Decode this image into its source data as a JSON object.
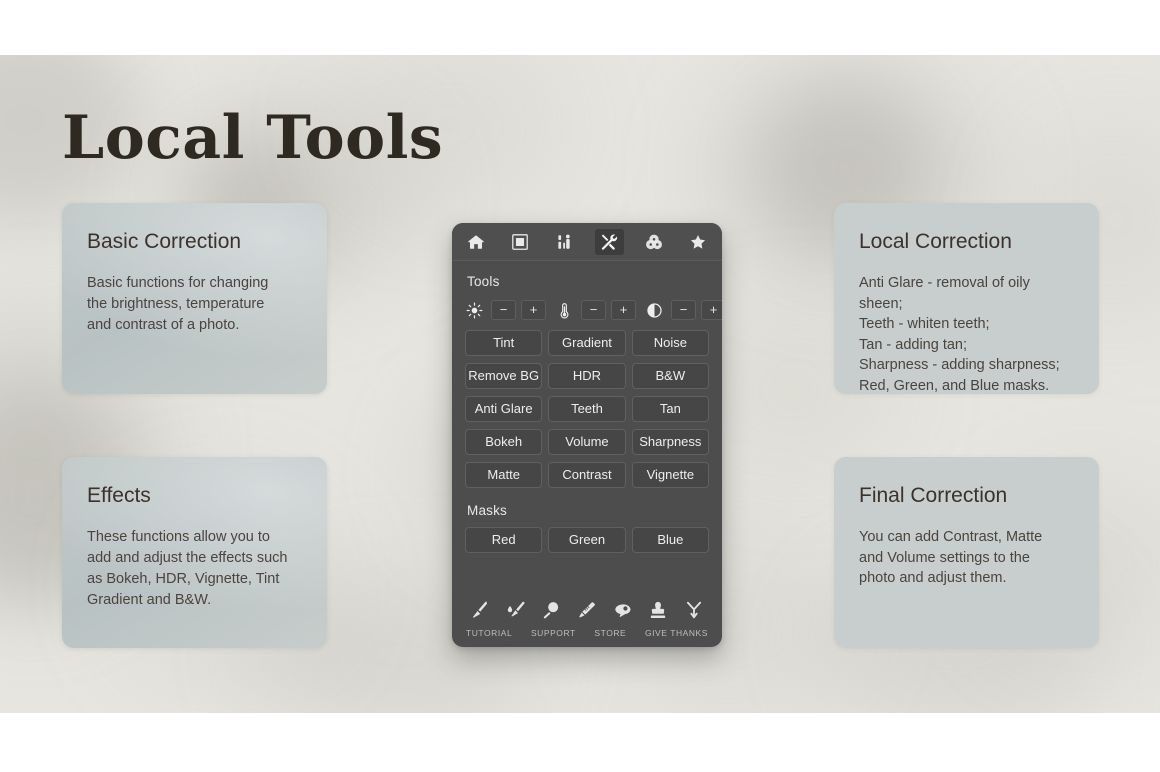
{
  "page": {
    "title": "Local Tools",
    "background_color": "#e6e5df",
    "title_color": "#2e2a22"
  },
  "cards": [
    {
      "id": "basic",
      "title": "Basic Correction",
      "body": "Basic functions for changing\nthe brightness, temperature\nand contrast of a photo."
    },
    {
      "id": "effects",
      "title": "Effects",
      "body": "These functions allow you to\nadd and adjust the effects such\nas Bokeh, HDR, Vignette, Tint\nGradient and B&W."
    },
    {
      "id": "local",
      "title": "Local Correction",
      "body": "Anti Glare - removal of oily sheen;\nTeeth - whiten teeth;\nTan - adding tan;\nSharpness - adding sharpness;\nRed, Green, and Blue masks."
    },
    {
      "id": "final",
      "title": "Final Correction",
      "body": "You can add Contrast, Matte\nand Volume settings to the\nphoto and adjust them."
    }
  ],
  "panel": {
    "background_color": "#4d4d4d",
    "tabs": [
      {
        "name": "home-icon",
        "label": "Home",
        "active": false
      },
      {
        "name": "frame-icon",
        "label": "Frame",
        "active": false
      },
      {
        "name": "makeup-icon",
        "label": "Makeup",
        "active": false
      },
      {
        "name": "tools-icon",
        "label": "Tools",
        "active": true
      },
      {
        "name": "color-mix-icon",
        "label": "Color",
        "active": false
      },
      {
        "name": "star-icon",
        "label": "Favorites",
        "active": false
      }
    ],
    "tools_label": "Tools",
    "adjusters": [
      {
        "icon": "brightness-icon",
        "label": "Brightness",
        "minus": "−",
        "plus": "+"
      },
      {
        "icon": "temperature-icon",
        "label": "Temperature",
        "minus": "−",
        "plus": "+"
      },
      {
        "icon": "contrast-icon",
        "label": "Contrast",
        "minus": "−",
        "plus": "+"
      }
    ],
    "tool_buttons": [
      "Tint",
      "Gradient",
      "Noise",
      "Remove BG",
      "HDR",
      "B&W",
      "Anti Glare",
      "Teeth",
      "Tan",
      "Bokeh",
      "Volume",
      "Sharpness",
      "Matte",
      "Contrast",
      "Vignette"
    ],
    "masks_label": "Masks",
    "mask_buttons": [
      "Red",
      "Green",
      "Blue"
    ],
    "bottom_icons": [
      {
        "name": "brush-icon",
        "label": "Brush"
      },
      {
        "name": "wet-brush-icon",
        "label": "Wet Brush"
      },
      {
        "name": "magnifier-icon",
        "label": "Zoom"
      },
      {
        "name": "eraser-icon",
        "label": "Eraser"
      },
      {
        "name": "lasso-icon",
        "label": "Lasso"
      },
      {
        "name": "stamp-icon",
        "label": "Stamp"
      },
      {
        "name": "clone-icon",
        "label": "Clone"
      }
    ],
    "bottom_labels": [
      "TUTORIAL",
      "SUPPORT",
      "STORE",
      "GIVE THANKS"
    ]
  }
}
